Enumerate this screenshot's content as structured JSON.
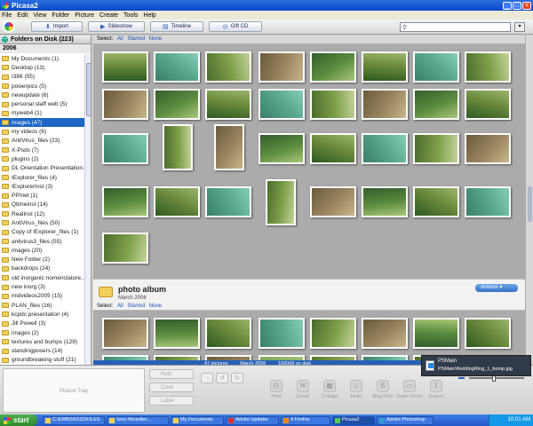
{
  "window": {
    "title": "Picasa2"
  },
  "menu": [
    "File",
    "Edit",
    "View",
    "Folder",
    "Picture",
    "Create",
    "Tools",
    "Help"
  ],
  "toolbar": {
    "import": "Import",
    "slideshow": "Slideshow",
    "timeline": "Timeline",
    "giftcd": "Gift CD",
    "search_value": ""
  },
  "sidebar": {
    "header": "Folders on Disk (223)",
    "year": "2006",
    "items": [
      {
        "label": "My Documents (1)"
      },
      {
        "label": "Desktop (13)"
      },
      {
        "label": "I386 (55)"
      },
      {
        "label": "powerpics (5)"
      },
      {
        "label": "newupdate (6)"
      },
      {
        "label": "personal staff web (5)"
      },
      {
        "label": "myweb4 (1)"
      },
      {
        "label": "images (47)",
        "selected": true
      },
      {
        "label": "my videos (6)"
      },
      {
        "label": "AntiVirus_files (23)"
      },
      {
        "label": "X-Psds (7)"
      },
      {
        "label": "plugins (2)"
      },
      {
        "label": "DL Orientation Presentation..."
      },
      {
        "label": "IExplorer_files (4)"
      },
      {
        "label": "IExplorerInst (3)"
      },
      {
        "label": "PPInet (1)"
      },
      {
        "label": "Qtimeinst (14)"
      },
      {
        "label": "RealInst (12)"
      },
      {
        "label": "AntiVirus_files (50)"
      },
      {
        "label": "Copy of IExplorer_files (1)"
      },
      {
        "label": "antivirus3_files (55)"
      },
      {
        "label": "images (20)"
      },
      {
        "label": "New Folder (2)"
      },
      {
        "label": "backdrops (24)"
      },
      {
        "label": "old inorganic nomenclature..."
      },
      {
        "label": "new inorg (3)"
      },
      {
        "label": "midvideos2005 (15)"
      },
      {
        "label": "PLAN_files (16)"
      },
      {
        "label": "kcpdc presentation (4)"
      },
      {
        "label": "Jill Powell (3)"
      },
      {
        "label": "images (2)"
      },
      {
        "label": "textures and bumps (129)"
      },
      {
        "label": "standingposers (14)"
      },
      {
        "label": "groundbreaking stuff (21)"
      }
    ]
  },
  "selbar": {
    "label": "Select:",
    "all": "All",
    "starred": "Starred",
    "none": "None"
  },
  "album": {
    "name": "photo album",
    "date": "March 2006",
    "actions": "Actions"
  },
  "status": {
    "count": "47 pictures",
    "date": "March 2006",
    "size": "100068 on disk"
  },
  "bottom": {
    "tray": "Picture Tray",
    "hold": "Hold",
    "clear": "Clear",
    "label": "Label",
    "actions": [
      "Print",
      "Email",
      "Collage",
      "Hello",
      "BlogThis!",
      "Order Prints",
      "Export"
    ]
  },
  "popup": {
    "title": "PSMain",
    "file": "PSMainWeddingRing_1_bump.jpg"
  },
  "taskbar": {
    "start": "start",
    "tasks": [
      "C:\\EMBSRD32\\FILES",
      "\\\\xxx-file\\edtec...",
      "My Documents",
      "Adobe Updater",
      "4 Firefox",
      "Picasa2",
      "Adobe Photoshop"
    ],
    "clock": "10:01 AM"
  }
}
